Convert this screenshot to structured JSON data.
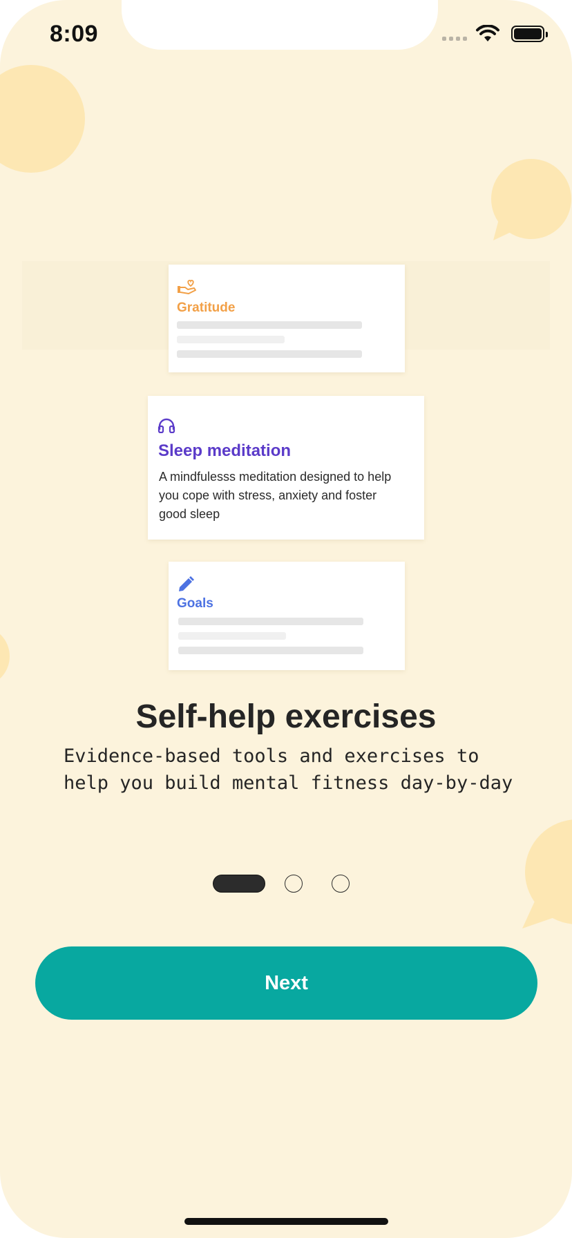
{
  "status_bar": {
    "time": "8:09"
  },
  "cards": {
    "gratitude": {
      "title": "Gratitude",
      "icon": "hand-heart-icon",
      "color": "#f2a047"
    },
    "sleep": {
      "title": "Sleep meditation",
      "icon": "headphones-icon",
      "color": "#5b3bc9",
      "description": "A mindfulesss meditation designed to help you cope with stress, anxiety and foster good sleep"
    },
    "goals": {
      "title": "Goals",
      "icon": "pencil-icon",
      "color": "#4d72e2"
    }
  },
  "onboarding": {
    "headline": "Self-help exercises",
    "subtitle": "Evidence-based tools and exercises to help you build mental fitness day-by-day",
    "page_indicator": {
      "current": 1,
      "total": 3
    }
  },
  "actions": {
    "next_label": "Next"
  },
  "colors": {
    "background": "#fcf3dc",
    "accent": "#08a8a0",
    "bubble": "#fde7b3"
  }
}
